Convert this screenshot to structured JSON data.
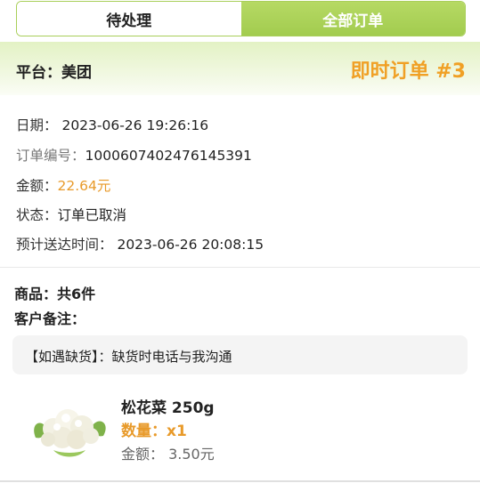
{
  "tabs": [
    {
      "label": "待处理",
      "active": true
    },
    {
      "label": "全部订单",
      "active": false
    }
  ],
  "platform": {
    "label": "平台：",
    "value": "美团"
  },
  "order_type": {
    "label": "即时订单",
    "number": "#3"
  },
  "info": {
    "date_label": "日期：",
    "date_value": "2023-06-26 19:26:16",
    "order_no_label": "订单编号：",
    "order_no_value": "1000607402476145391",
    "amount_label": "金额：",
    "amount_value": "22.64元",
    "status_label": "状态：",
    "status_value": "订单已取消",
    "eta_label": "预计送达时间：",
    "eta_value": "2023-06-26 20:08:15"
  },
  "goods": {
    "label": "商品：",
    "value": "共6件"
  },
  "customer_note": {
    "label": "客户备注：",
    "box_text": "【如遇缺货】：缺货时电话与我沟通"
  },
  "products": [
    {
      "name": "松花菜 250g",
      "qty_label": "数量：",
      "qty_value": "x1",
      "price_label": "金额：",
      "price_value": "3.50元",
      "icon": "cauliflower-image"
    }
  ],
  "colors": {
    "accent_green": "#a9cf5a",
    "accent_orange": "#f0a025"
  }
}
